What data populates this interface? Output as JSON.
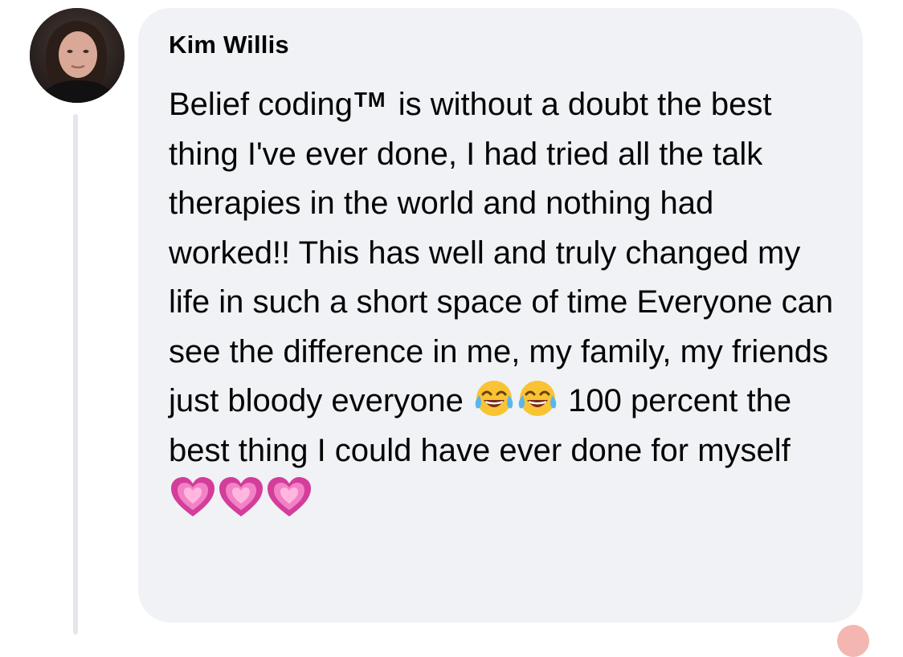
{
  "comment": {
    "author": "Kim Willis",
    "trademark": "TM",
    "text_parts": {
      "before_tm": "Belief coding",
      "after_tm": " is without a doubt the best thing I've ever done, I had tried all the talk therapies in the world and nothing had worked!! This has well and truly changed my life in such a short space of time Everyone can see the difference in me, my family, my friends just bloody everyone ",
      "after_laugh": " 100 percent the best thing I could have ever done for myself "
    },
    "emojis": {
      "laugh": "face-with-tears-of-joy-icon",
      "heart": "growing-heart-icon"
    }
  },
  "colors": {
    "bubble": "#f0f2f5",
    "thread_line": "#e4e6eb",
    "text": "#050505"
  }
}
